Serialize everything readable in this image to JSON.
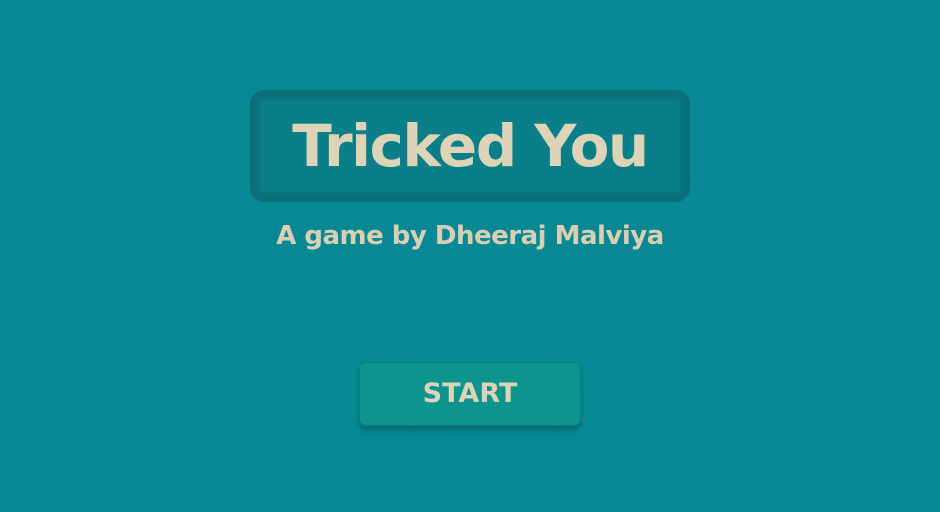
{
  "game": {
    "title": "Tricked You",
    "subtitle": "A game by Dheeraj Malviya",
    "start_label": "START"
  },
  "colors": {
    "background": "#088b96",
    "title_border": "#0a6f78",
    "text": "#ddd3b6",
    "button": "#0c958f"
  }
}
